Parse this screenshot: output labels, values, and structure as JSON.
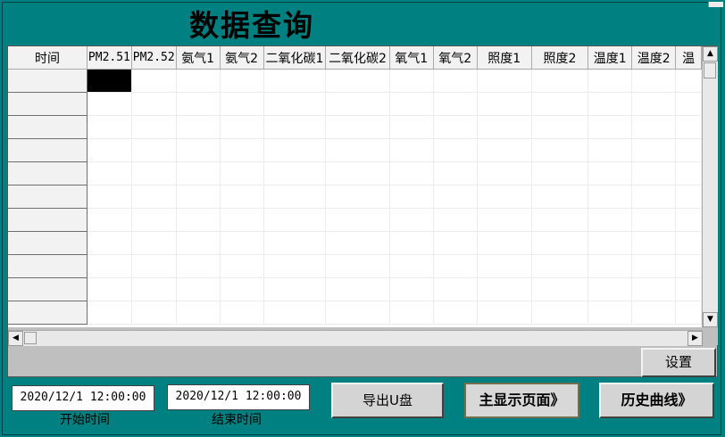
{
  "title": "数据查询",
  "grid": {
    "headers": [
      "时间",
      "PM2.51",
      "PM2.52",
      "氨气1",
      "氨气2",
      "二氧化碳1",
      "二氧化碳2",
      "氧气1",
      "氧气2",
      "照度1",
      "照度2",
      "温度1",
      "温度2",
      "温"
    ],
    "visible_rows": 11
  },
  "buttons": {
    "settings": "设置",
    "export": "导出U盘",
    "main_page": "主显示页面》",
    "history_curve": "历史曲线》"
  },
  "time_range": {
    "start_value": "2020/12/1 12:00:00",
    "start_label": "开始时间",
    "end_value": "2020/12/1 12:00:00",
    "end_label": "结束时间"
  },
  "scroll_arrows": {
    "up": "▲",
    "down": "▼",
    "left": "◀",
    "right": "▶"
  }
}
